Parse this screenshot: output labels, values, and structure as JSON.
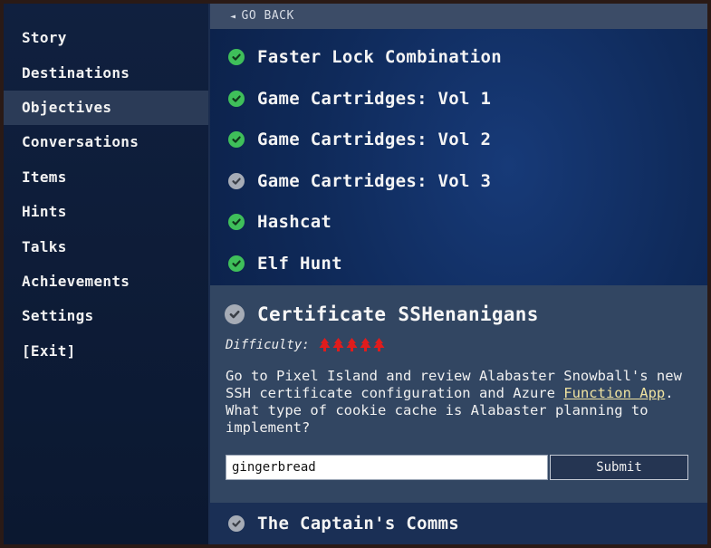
{
  "sidebar": {
    "items": [
      {
        "label": "Story"
      },
      {
        "label": "Destinations"
      },
      {
        "label": "Objectives",
        "active": true
      },
      {
        "label": "Conversations"
      },
      {
        "label": "Items"
      },
      {
        "label": "Hints"
      },
      {
        "label": "Talks"
      },
      {
        "label": "Achievements"
      },
      {
        "label": "Settings"
      },
      {
        "label": "[Exit]"
      }
    ]
  },
  "header": {
    "goback_arrow": "◄",
    "goback_label": "GO BACK"
  },
  "objectives": [
    {
      "title": "Faster Lock Combination",
      "status": "done"
    },
    {
      "title": "Game Cartridges: Vol 1",
      "status": "done"
    },
    {
      "title": "Game Cartridges: Vol 2",
      "status": "done"
    },
    {
      "title": "Game Cartridges: Vol 3",
      "status": "todo"
    },
    {
      "title": "Hashcat",
      "status": "done"
    },
    {
      "title": "Elf Hunt",
      "status": "done"
    }
  ],
  "expanded": {
    "title": "Certificate SSHenanigans",
    "status": "todo",
    "difficulty_label": "Difficulty:",
    "difficulty_level": 5,
    "difficulty_icon": "tree-icon",
    "description_pre": "Go to Pixel Island and review Alabaster Snowball's new SSH certificate configuration and Azure ",
    "description_link": "Function App",
    "description_post": ". What type of cookie cache is Alabaster planning to implement?",
    "answer_value": "gingerbread",
    "submit_label": "Submit"
  },
  "next_objective": {
    "title": "The Captain's Comms",
    "status": "todo"
  },
  "colors": {
    "done": "#3fbf5a",
    "todo": "#a6acb6",
    "difficulty_tree": "#e01c1c",
    "link": "#f0e3a0"
  }
}
